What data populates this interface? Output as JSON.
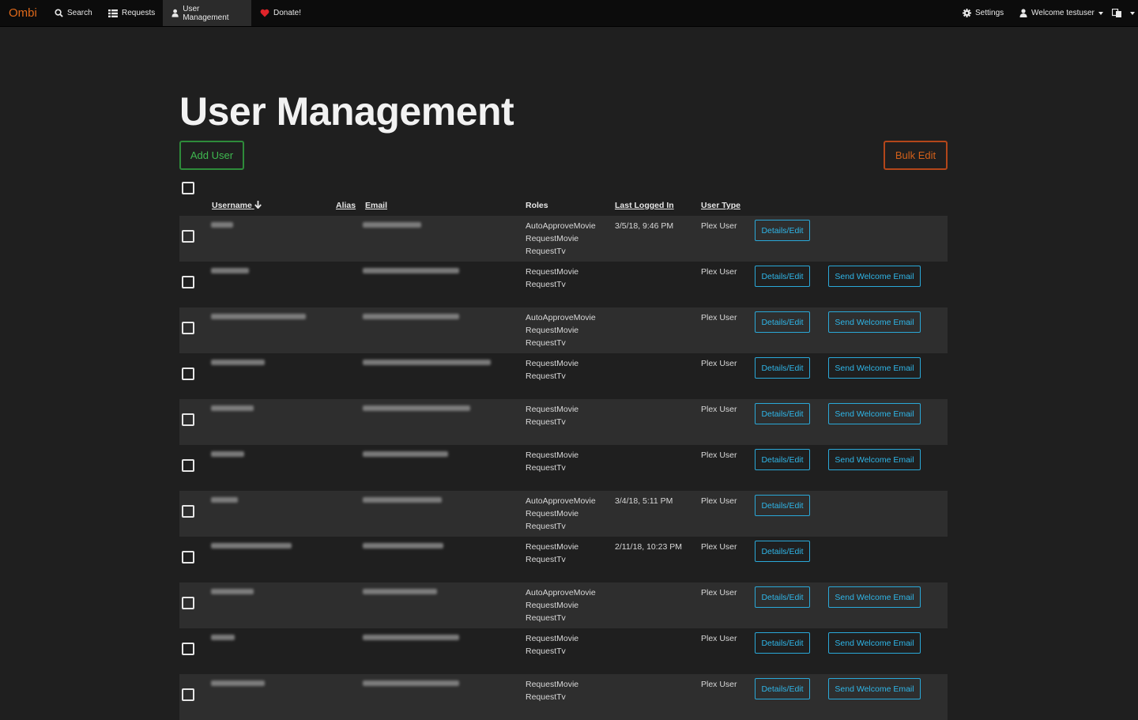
{
  "nav": {
    "brand": "Ombi",
    "search": "Search",
    "requests": "Requests",
    "user_management": "User Management",
    "donate": "Donate!",
    "settings": "Settings",
    "welcome": "Welcome testuser"
  },
  "page": {
    "title": "User Management",
    "add_user": "Add User",
    "bulk_edit": "Bulk Edit"
  },
  "table": {
    "headers": {
      "username": "Username",
      "alias": "Alias",
      "email": "Email",
      "roles": "Roles",
      "last_logged_in": "Last Logged In",
      "user_type": "User Type"
    },
    "details_label": "Details/Edit",
    "welcome_label": "Send Welcome Email",
    "rows": [
      {
        "r1": "AutoApproveMovie",
        "r2": "RequestMovie",
        "r3": "RequestTv",
        "last": "3/5/18, 9:46 PM",
        "type": "Plex User",
        "welcome": ""
      },
      {
        "r1": "RequestMovie",
        "r2": "RequestTv",
        "r3": "",
        "last": "",
        "type": "Plex User",
        "welcome": "Send Welcome Email"
      },
      {
        "r1": "AutoApproveMovie",
        "r2": "RequestMovie",
        "r3": "RequestTv",
        "last": "",
        "type": "Plex User",
        "welcome": "Send Welcome Email"
      },
      {
        "r1": "RequestMovie",
        "r2": "RequestTv",
        "r3": "",
        "last": "",
        "type": "Plex User",
        "welcome": "Send Welcome Email"
      },
      {
        "r1": "RequestMovie",
        "r2": "RequestTv",
        "r3": "",
        "last": "",
        "type": "Plex User",
        "welcome": "Send Welcome Email"
      },
      {
        "r1": "RequestMovie",
        "r2": "RequestTv",
        "r3": "",
        "last": "",
        "type": "Plex User",
        "welcome": "Send Welcome Email"
      },
      {
        "r1": "AutoApproveMovie",
        "r2": "RequestMovie",
        "r3": "RequestTv",
        "last": "3/4/18, 5:11 PM",
        "type": "Plex User",
        "welcome": ""
      },
      {
        "r1": "RequestMovie",
        "r2": "RequestTv",
        "r3": "",
        "last": "2/11/18, 10:23 PM",
        "type": "Plex User",
        "welcome": ""
      },
      {
        "r1": "AutoApproveMovie",
        "r2": "RequestMovie",
        "r3": "RequestTv",
        "last": "",
        "type": "Plex User",
        "welcome": "Send Welcome Email"
      },
      {
        "r1": "RequestMovie",
        "r2": "RequestTv",
        "r3": "",
        "last": "",
        "type": "Plex User",
        "welcome": "Send Welcome Email"
      },
      {
        "r1": "RequestMovie",
        "r2": "RequestTv",
        "r3": "",
        "last": "",
        "type": "Plex User",
        "welcome": "Send Welcome Email"
      }
    ]
  },
  "colors": {
    "brand": "#df691a",
    "add_user_border": "#2e8b3a",
    "bulk_edit_border": "#b3461a",
    "action_button": "#2aa8d8",
    "donate_heart": "#e0242a"
  }
}
